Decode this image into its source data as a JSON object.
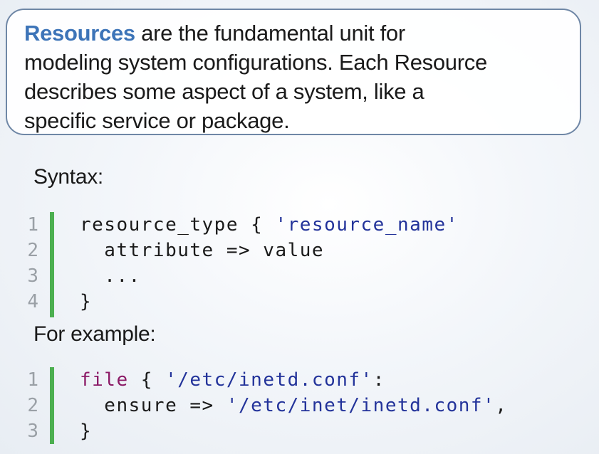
{
  "intro": {
    "term": "Resources",
    "lines": [
      " are the fundamental unit for",
      "modeling system configurations. Each Resource",
      "describes some aspect of a system, like a",
      "specific service or package."
    ],
    "term_color": "#3d74b8"
  },
  "syntax": {
    "heading": "Syntax:",
    "lines": [
      {
        "num": "1",
        "segments": [
          {
            "text": "resource_type { ",
            "kind": "plain"
          },
          {
            "text": "'resource_name'",
            "kind": "str"
          }
        ]
      },
      {
        "num": "2",
        "segments": [
          {
            "text": "  attribute => value",
            "kind": "plain"
          }
        ]
      },
      {
        "num": "3",
        "segments": [
          {
            "text": "  ...",
            "kind": "plain"
          }
        ]
      },
      {
        "num": "4",
        "segments": [
          {
            "text": "}",
            "kind": "plain"
          }
        ]
      }
    ]
  },
  "example": {
    "heading": "For example:",
    "lines": [
      {
        "num": "1",
        "segments": [
          {
            "text": "file",
            "kind": "kw"
          },
          {
            "text": " { ",
            "kind": "plain"
          },
          {
            "text": "'/etc/inetd.conf'",
            "kind": "str"
          },
          {
            "text": ":",
            "kind": "plain"
          }
        ]
      },
      {
        "num": "2",
        "segments": [
          {
            "text": "  ensure => ",
            "kind": "plain"
          },
          {
            "text": "'/etc/inet/inetd.conf'",
            "kind": "str"
          },
          {
            "text": ",",
            "kind": "plain"
          }
        ]
      },
      {
        "num": "3",
        "segments": [
          {
            "text": "}",
            "kind": "plain"
          }
        ]
      }
    ]
  },
  "colors": {
    "gutter_bar": "#4caf50",
    "string": "#23339a",
    "keyword": "#8b1a66",
    "line_number": "#9aa0a6"
  }
}
